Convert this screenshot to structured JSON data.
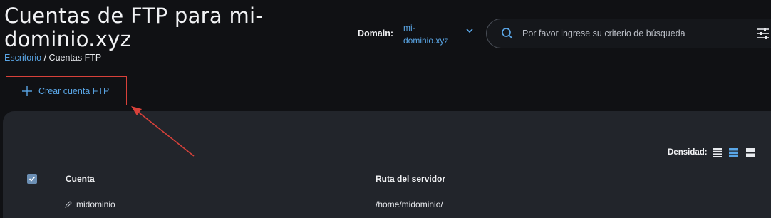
{
  "header": {
    "title": "Cuentas de FTP para mi-dominio.xyz",
    "breadcrumb": {
      "home": "Escritorio",
      "separator": "/",
      "current": "Cuentas FTP"
    }
  },
  "domain": {
    "label": "Domain:",
    "value": "mi-dominio.xyz"
  },
  "search": {
    "placeholder": "Por favor ingrese su criterio de búsqueda"
  },
  "actions": {
    "create_label": "Crear cuenta FTP"
  },
  "table": {
    "density_label": "Densidad:",
    "columns": [
      "Cuenta",
      "Ruta del servidor"
    ],
    "rows": [
      {
        "account": "midominio",
        "path": "/home/midominio/"
      }
    ]
  },
  "colors": {
    "accent": "#5aa6e6",
    "highlight": "#d8413a",
    "panel": "#22252b"
  }
}
